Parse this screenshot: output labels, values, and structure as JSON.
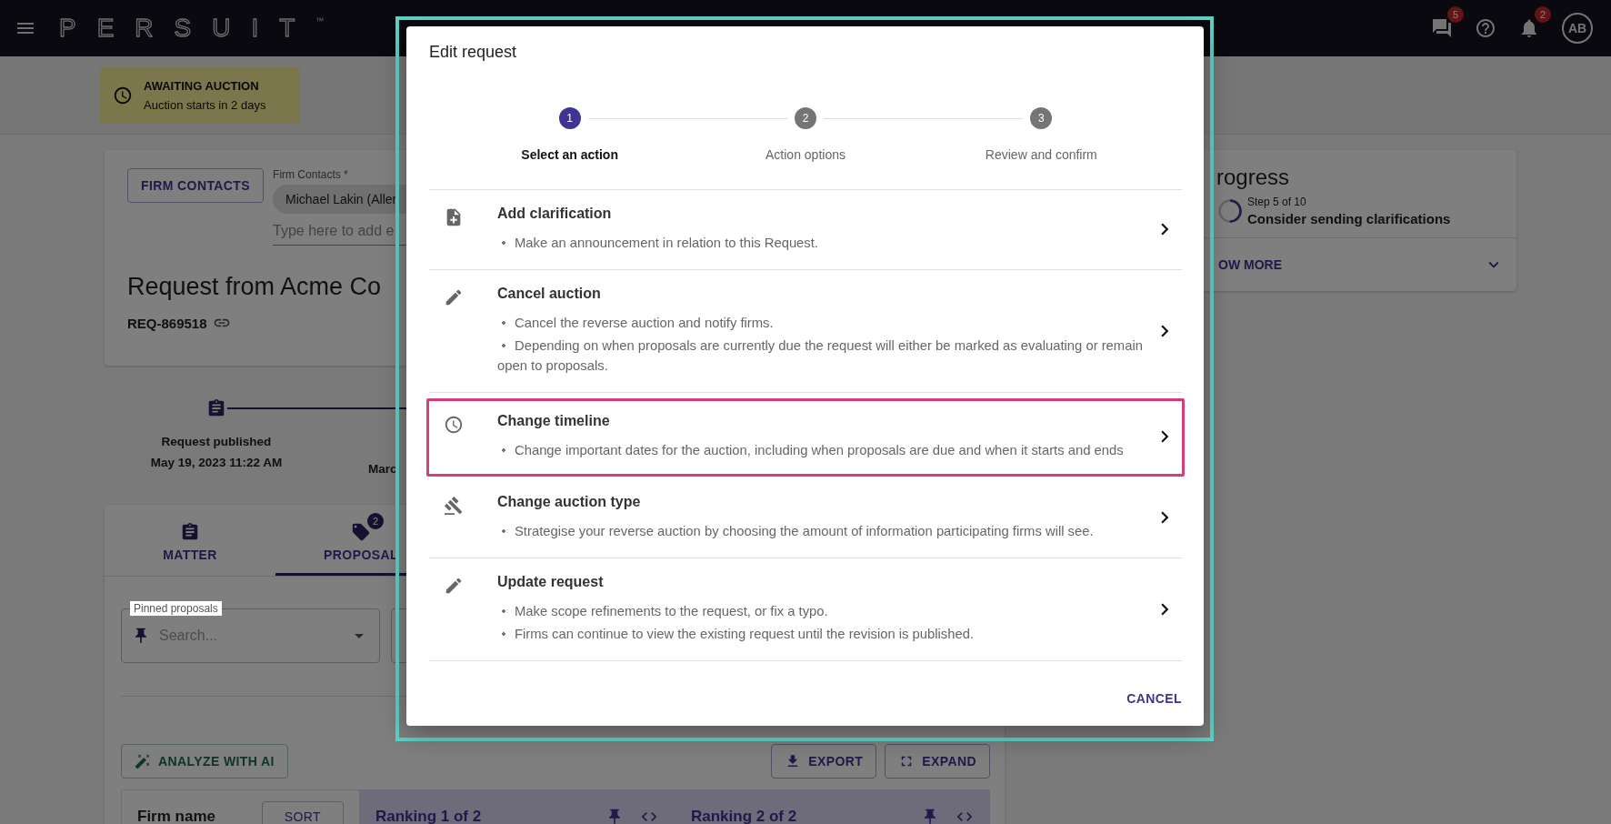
{
  "top_bar": {
    "logo": "PERSUIT",
    "trademark": "™",
    "messages_badge": "5",
    "notifications_badge": "2",
    "avatar": "AB"
  },
  "status_banner": {
    "title": "AWAITING AUCTION",
    "subtitle": "Auction starts in 2 days"
  },
  "request_card": {
    "firm_contacts_button": "FIRM CONTACTS",
    "contacts_label": "Firm Contacts *",
    "contact_chip": "Michael Lakin (Aller",
    "contact_placeholder": "Type here to add e",
    "title": "Request from Acme Co",
    "reference": "REQ-869518"
  },
  "timeline": [
    {
      "label": "Request published",
      "date": "May 19, 2023 11:22 AM"
    },
    {
      "date": "Marc"
    }
  ],
  "tabs": [
    {
      "label": "MATTER",
      "selected": false,
      "kind": "clipboard"
    },
    {
      "label": "PROPOSAL",
      "selected": true,
      "kind": "tag",
      "badge": "2"
    }
  ],
  "pinned_field": {
    "label": "Pinned proposals",
    "placeholder": "Search..."
  },
  "analyze_button": "ANALYZE WITH AI",
  "export_button": "EXPORT",
  "expand_button": "EXPAND",
  "table": {
    "firm_column": "Firm name",
    "sort_button": "SORT",
    "rankings": [
      "Ranking 1 of 2",
      "Ranking 2 of 2"
    ]
  },
  "progress": {
    "title": "rogress",
    "step": "Step 5 of 10",
    "task": "Consider sending clarifications",
    "toggle": "OW MORE",
    "level": 0.5
  },
  "dialog": {
    "title": "Edit request",
    "steps": [
      {
        "number": "1",
        "label": "Select an action",
        "active": true
      },
      {
        "number": "2",
        "label": "Action options",
        "active": false
      },
      {
        "number": "3",
        "label": "Review and confirm",
        "active": false
      }
    ],
    "actions": [
      {
        "kind": "clarification",
        "title": "Add clarification",
        "highlighted": false,
        "bullets": [
          "Make an announcement in relation to this Request."
        ]
      },
      {
        "kind": "edit",
        "title": "Cancel auction",
        "highlighted": false,
        "bullets": [
          "Cancel the reverse auction and notify firms.",
          "Depending on when proposals are currently due the request will either be marked as evaluating or remain open to proposals."
        ]
      },
      {
        "kind": "clock",
        "title": "Change timeline",
        "highlighted": true,
        "bullets": [
          "Change important dates for the auction, including when proposals are due and when it starts and ends"
        ]
      },
      {
        "kind": "gavel",
        "title": "Change auction type",
        "highlighted": false,
        "bullets": [
          "Strategise your reverse auction by choosing the amount of information participating firms will see."
        ]
      },
      {
        "kind": "edit",
        "title": "Update request",
        "highlighted": false,
        "bullets": [
          "Make scope refinements to the request, or fix a typo.",
          "Firms can continue to view the existing request until the revision is published."
        ]
      }
    ],
    "cancel_button": "CANCEL"
  }
}
